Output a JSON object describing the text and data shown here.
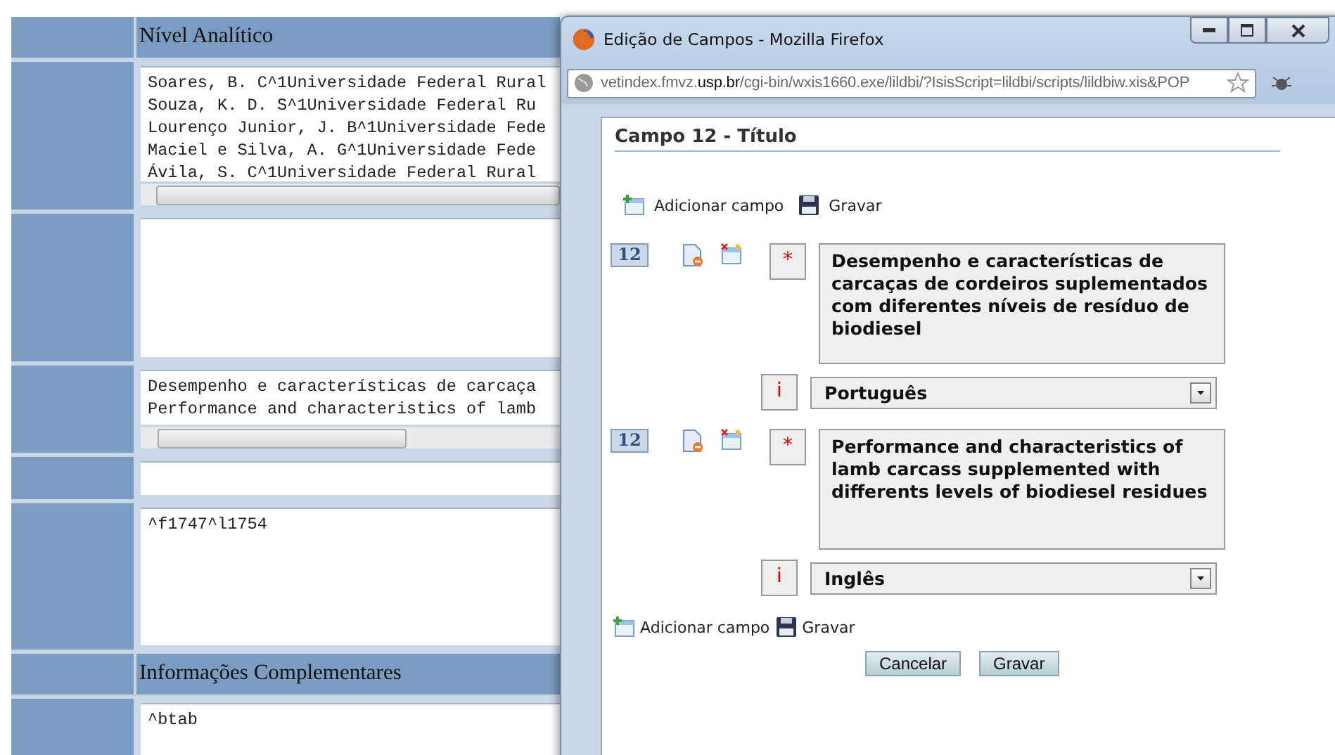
{
  "background_form": {
    "rows": [
      {
        "kind": "header",
        "text": "Nível Analítico"
      },
      {
        "kind": "textarea",
        "lines": [
          "Soares, B. C^1Universidade Federal Rural",
          "Souza, K. D. S^1Universidade Federal Ru",
          "Lourenço Junior, J. B^1Universidade Fede",
          "Maciel e Silva, A. G^1Universidade Fede",
          "Ávila, S. C^1Universidade Federal Rural"
        ],
        "h_scroll": true
      },
      {
        "kind": "textarea",
        "lines": [],
        "h_scroll": false
      },
      {
        "kind": "textarea",
        "lines": [
          "Desempenho e características de carcaça",
          "Performance and characteristics of lamb"
        ],
        "h_scroll": true
      },
      {
        "kind": "input",
        "lines": [],
        "h_scroll": false
      },
      {
        "kind": "textarea",
        "lines": [
          "^f1747^l1754"
        ],
        "h_scroll": false
      },
      {
        "kind": "header",
        "text": "Informações Complementares"
      },
      {
        "kind": "textarea",
        "lines": [
          "^btab"
        ],
        "h_scroll": false
      }
    ]
  },
  "popup": {
    "window": {
      "title": "Edição de Campos - Mozilla Firefox"
    },
    "address_bar": {
      "url": "vetindex.fmvz.**usp.br**/cgi-bin/wxis1660.exe/lildbi/?IsisScript=lildbi/scripts/lildbiw.xis&POP"
    },
    "panel": {
      "title": "Campo 12 - Título",
      "top_toolbar": [
        {
          "kind": "add",
          "label": "Adicionar campo"
        },
        {
          "kind": "save",
          "label": "Gravar"
        }
      ],
      "fields": [
        {
          "tag": "12",
          "required_mark": "*",
          "value": "Desempenho e características de carcaças de cordeiros suplementados com diferentes níveis de resíduo de biodiesel",
          "lang_mark": "i",
          "language": "Português"
        },
        {
          "tag": "12",
          "required_mark": "*",
          "value": "Performance and characteristics of lamb carcass supplemented with differents levels of biodiesel residues",
          "lang_mark": "i",
          "language": "Inglês"
        }
      ],
      "bottom_toolbar": [
        {
          "kind": "add",
          "label": "Adicionar campo"
        },
        {
          "kind": "save",
          "label": "Gravar"
        }
      ],
      "buttons": [
        "Cancelar",
        "Gravar"
      ]
    }
  }
}
